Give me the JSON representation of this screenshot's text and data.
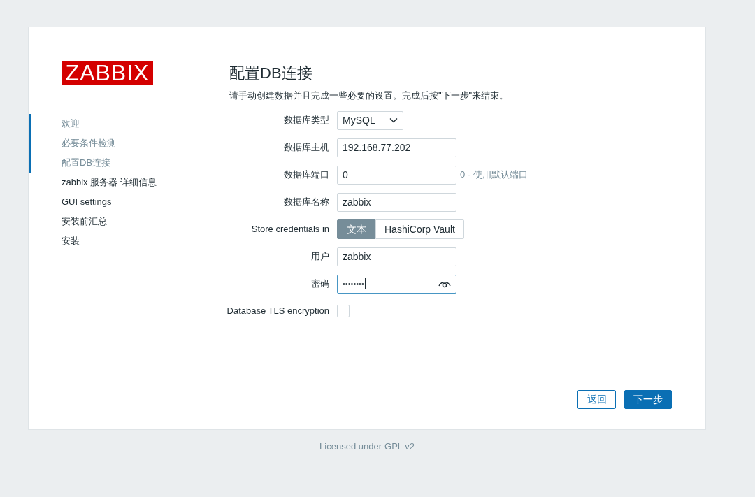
{
  "logo": "ZABBIX",
  "steps": [
    {
      "label": "欢迎",
      "completed": true
    },
    {
      "label": "必要条件检测",
      "completed": true
    },
    {
      "label": "配置DB连接",
      "completed": true
    },
    {
      "label": "zabbix 服务器 详细信息",
      "completed": false
    },
    {
      "label": "GUI settings",
      "completed": false
    },
    {
      "label": "安装前汇总",
      "completed": false
    },
    {
      "label": "安装",
      "completed": false
    }
  ],
  "title": "配置DB连接",
  "description": "请手动创建数据并且完成一些必要的设置。完成后按\"下一步\"来结束。",
  "form": [
    {
      "kind": "select",
      "label": "数据库类型",
      "value": "MySQL"
    },
    {
      "kind": "text",
      "label": "数据库主机",
      "value": "192.168.77.202"
    },
    {
      "kind": "text",
      "label": "数据库端口",
      "value": "0",
      "hint": "0 - 使用默认端口"
    },
    {
      "kind": "text",
      "label": "数据库名称",
      "value": "zabbix"
    },
    {
      "kind": "segmented",
      "label": "Store credentials in",
      "options": [
        {
          "label": "文本",
          "selected": true
        },
        {
          "label": "HashiCorp Vault",
          "selected": false
        }
      ]
    },
    {
      "kind": "text",
      "label": "用户",
      "value": "zabbix"
    },
    {
      "kind": "password",
      "label": "密码",
      "value": "••••••••",
      "focused": true
    },
    {
      "kind": "checkbox",
      "label": "Database TLS encryption",
      "checked": false
    }
  ],
  "buttons": [
    {
      "label": "返回",
      "kind": "secondary"
    },
    {
      "label": "下一步",
      "kind": "primary"
    }
  ],
  "footer": {
    "text": "Licensed under",
    "link": "GPL v2"
  }
}
